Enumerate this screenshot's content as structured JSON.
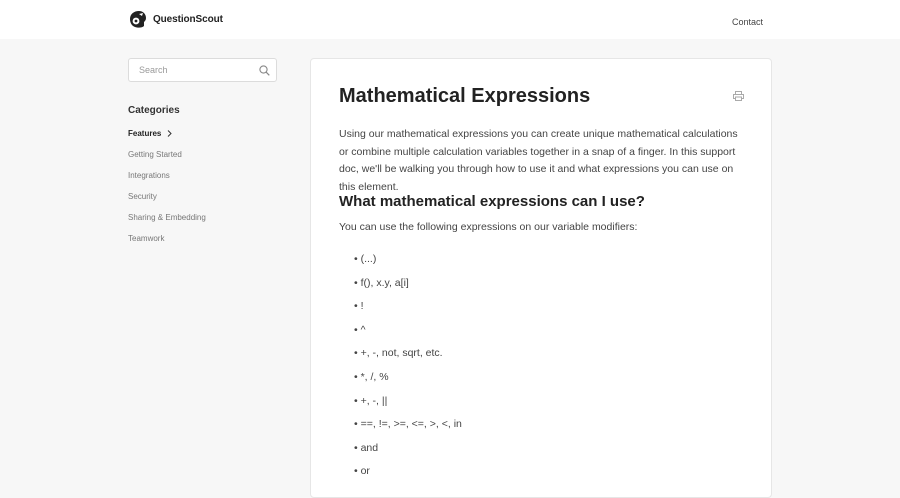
{
  "header": {
    "brand": "QuestionScout",
    "contact_label": "Contact"
  },
  "sidebar": {
    "search_placeholder": "Search",
    "categories_title": "Categories",
    "items": [
      {
        "label": "Features",
        "active": true
      },
      {
        "label": "Getting Started",
        "active": false
      },
      {
        "label": "Integrations",
        "active": false
      },
      {
        "label": "Security",
        "active": false
      },
      {
        "label": "Sharing & Embedding",
        "active": false
      },
      {
        "label": "Teamwork",
        "active": false
      }
    ]
  },
  "article": {
    "title": "Mathematical Expressions",
    "intro": "Using our mathematical expressions you can create unique mathematical calculations or combine multiple calculation variables together in a snap of a finger. In this support doc, we'll be walking you through how to use it and what expressions you can use on this element.",
    "section_heading": "What mathematical expressions can I use?",
    "section_text": "You can use the following expressions on our variable modifiers:",
    "modifiers": [
      "(...)",
      "f(), x.y, a[i]",
      "!",
      "^",
      "+, -, not, sqrt, etc.",
      "*, /, %",
      "+, -, ||",
      "==, !=, >=, <=, >, <, in",
      "and",
      "or"
    ]
  },
  "icons": {
    "logo": "questionscout-logo-icon",
    "search": "search-icon",
    "chevron": "chevron-right-icon",
    "print": "print-icon"
  }
}
